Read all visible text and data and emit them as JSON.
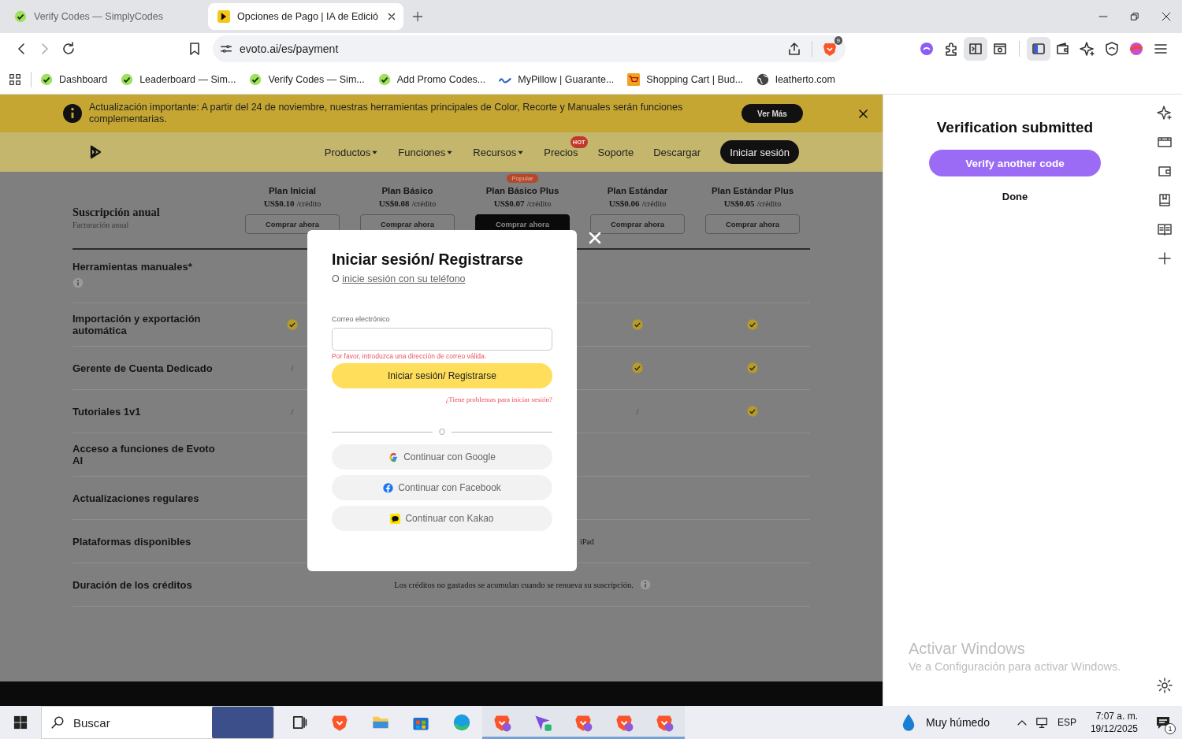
{
  "browser": {
    "tabs": [
      {
        "title": "Verify Codes — SimplyCodes",
        "kind": "simplycodes",
        "selected": false
      },
      {
        "title": "Opciones de Pago | IA de Edició",
        "kind": "evoto",
        "selected": true
      }
    ],
    "address": "evoto.ai/es/payment",
    "shields_count": "9",
    "toolbar_buttons": [
      {
        "kind": "leo",
        "active": false
      },
      {
        "kind": "puzzle",
        "active": false
      },
      {
        "kind": "split",
        "active": true
      },
      {
        "kind": "tabsearch",
        "active": false
      },
      {
        "kind": "sidebar",
        "active": true
      },
      {
        "kind": "wallet",
        "active": false
      },
      {
        "kind": "sparkle",
        "active": false
      },
      {
        "kind": "vpn",
        "active": false
      },
      {
        "kind": "profile",
        "active": false
      }
    ],
    "bookmarks": [
      {
        "label": "Dashboard",
        "kind": "simplycodes"
      },
      {
        "label": "Leaderboard — Sim...",
        "kind": "simplycodes"
      },
      {
        "label": "Verify Codes — Sim...",
        "kind": "simplycodes"
      },
      {
        "label": "Add Promo Codes...",
        "kind": "simplycodes"
      },
      {
        "label": "MyPillow | Guarante...",
        "kind": "mypillow"
      },
      {
        "label": "Shopping Cart | Bud...",
        "kind": "cart"
      },
      {
        "label": "leatherto.com",
        "kind": "globe"
      }
    ]
  },
  "page": {
    "banner": {
      "text": "Actualización importante: A partir del 24 de noviembre, nuestras herramientas principales de Color, Recorte y Manuales serán funciones complementarias.",
      "button": "Ver Más"
    },
    "nav": {
      "items": [
        {
          "label": "Productos",
          "dropdown": true
        },
        {
          "label": "Funciones",
          "dropdown": true
        },
        {
          "label": "Recursos",
          "dropdown": true
        },
        {
          "label": "Precios",
          "dropdown": false,
          "badge": "HOT"
        },
        {
          "label": "Soporte",
          "dropdown": false
        },
        {
          "label": "Descargar",
          "dropdown": false
        }
      ],
      "login": "Iniciar sesión"
    },
    "pricing": {
      "title": "Suscripción anual",
      "subtitle": "Facturación anual",
      "plans": [
        {
          "name": "Plan Inicial",
          "price": "US$0.10",
          "unit": "/crédito",
          "button": "Comprar ahora",
          "featured": false
        },
        {
          "name": "Plan Básico",
          "price": "US$0.08",
          "unit": "/crédito",
          "button": "Comprar ahora",
          "featured": false
        },
        {
          "name": "Plan Básico Plus",
          "price": "US$0.07",
          "unit": "/crédito",
          "button": "Comprar ahora",
          "featured": true,
          "badge": "Popular"
        },
        {
          "name": "Plan Estándar",
          "price": "US$0.06",
          "unit": "/crédito",
          "button": "Comprar ahora",
          "featured": false
        },
        {
          "name": "Plan Estándar Plus",
          "price": "US$0.05",
          "unit": "/crédito",
          "button": "Comprar ahora",
          "featured": false
        }
      ],
      "rows": [
        {
          "label": "Herramientas manuales*",
          "info": true
        },
        {
          "label": "Importación y exportación automática",
          "info": false,
          "cells": [
            {
              "kind": "check"
            },
            {
              "kind": "none"
            },
            {
              "kind": "none"
            },
            {
              "kind": "check"
            },
            {
              "kind": "check"
            }
          ]
        },
        {
          "label": "Gerente de Cuenta Dedicado",
          "info": false,
          "cells": [
            {
              "kind": "text",
              "text": "/"
            },
            {
              "kind": "none"
            },
            {
              "kind": "none"
            },
            {
              "kind": "check"
            },
            {
              "kind": "check"
            }
          ]
        },
        {
          "label": "Tutoriales 1v1",
          "info": false,
          "cells": [
            {
              "kind": "text",
              "text": "/"
            },
            {
              "kind": "none"
            },
            {
              "kind": "none"
            },
            {
              "kind": "text",
              "text": "/"
            },
            {
              "kind": "check"
            }
          ]
        },
        {
          "label": "Acceso a funciones de Evoto AI",
          "info": false
        },
        {
          "label": "Actualizaciones regulares",
          "info": false
        },
        {
          "label": "Plataformas disponibles",
          "info": false,
          "cells": [
            {
              "kind": "none"
            },
            {
              "kind": "none"
            },
            {
              "kind": "none"
            },
            {
              "kind": "start",
              "text": "iPad"
            }
          ]
        },
        {
          "label": "Duración de los créditos",
          "info": false,
          "note": "Los créditos no gastados se acumulan cuando se renueva su suscripción.",
          "note_info": true
        }
      ]
    }
  },
  "modal": {
    "title": "Iniciar sesión/ Registrarse",
    "alt_prefix": "O",
    "alt_link": "inicie sesión con su teléfono",
    "email_label": "Correo electrónico",
    "error": "Por favor, introduzca una dirección de correo válida.",
    "submit": "Iniciar sesión/ Registrarse",
    "trouble": "¿Tiene problemas para iniciar sesión?",
    "divider": "O",
    "social": [
      {
        "label": "Continuar con Google",
        "kind": "google"
      },
      {
        "label": "Continuar con Facebook",
        "kind": "facebook"
      },
      {
        "label": "Continuar con Kakao",
        "kind": "kakao"
      }
    ]
  },
  "side_panel": {
    "title": "Verification submitted",
    "primary": "Verify another code",
    "secondary": "Done"
  },
  "watermark": {
    "title": "Activar Windows",
    "text": "Ve a Configuración para activar Windows."
  },
  "taskbar": {
    "search_placeholder": "Buscar",
    "apps": [
      {
        "kind": "taskview",
        "running": false
      },
      {
        "kind": "brave",
        "running": false
      },
      {
        "kind": "folder",
        "running": false
      },
      {
        "kind": "store",
        "running": false
      },
      {
        "kind": "edge",
        "running": false
      },
      {
        "kind": "brave-profile",
        "running": true
      },
      {
        "kind": "app",
        "running": true
      },
      {
        "kind": "brave-profile",
        "running": true
      },
      {
        "kind": "brave-profile",
        "running": true
      },
      {
        "kind": "brave-profile",
        "running": true
      }
    ],
    "weather": "Muy húmedo",
    "language": "ESP",
    "time": "7:07 a. m.",
    "date": "19/12/2025",
    "notifications": "1"
  }
}
